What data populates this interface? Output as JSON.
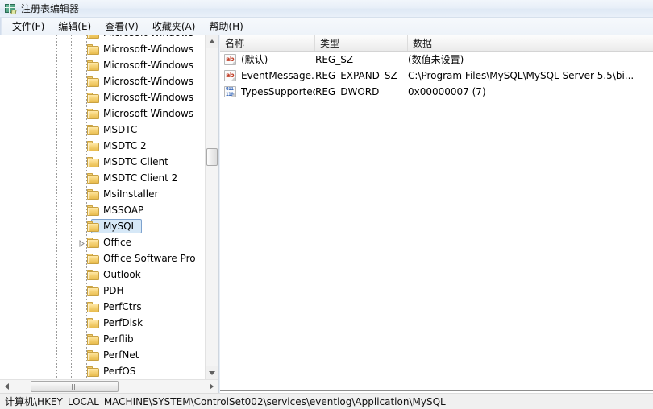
{
  "window": {
    "title": "注册表编辑器",
    "icon": "regedit-icon"
  },
  "menubar": {
    "items": [
      {
        "label": "文件(F)",
        "name": "menu-file"
      },
      {
        "label": "编辑(E)",
        "name": "menu-edit"
      },
      {
        "label": "查看(V)",
        "name": "menu-view"
      },
      {
        "label": "收藏夹(A)",
        "name": "menu-favorites"
      },
      {
        "label": "帮助(H)",
        "name": "menu-help"
      }
    ]
  },
  "tree": {
    "items": [
      {
        "label": "Microsoft-Windows",
        "selected": false,
        "expandable": false
      },
      {
        "label": "Microsoft-Windows",
        "selected": false,
        "expandable": false
      },
      {
        "label": "Microsoft-Windows",
        "selected": false,
        "expandable": false
      },
      {
        "label": "Microsoft-Windows",
        "selected": false,
        "expandable": false
      },
      {
        "label": "Microsoft-Windows",
        "selected": false,
        "expandable": false
      },
      {
        "label": "Microsoft-Windows",
        "selected": false,
        "expandable": false
      },
      {
        "label": "MSDTC",
        "selected": false,
        "expandable": false
      },
      {
        "label": "MSDTC 2",
        "selected": false,
        "expandable": false
      },
      {
        "label": "MSDTC Client",
        "selected": false,
        "expandable": false
      },
      {
        "label": "MSDTC Client 2",
        "selected": false,
        "expandable": false
      },
      {
        "label": "MsiInstaller",
        "selected": false,
        "expandable": false
      },
      {
        "label": "MSSOAP",
        "selected": false,
        "expandable": false
      },
      {
        "label": "MySQL",
        "selected": true,
        "expandable": false
      },
      {
        "label": "Office",
        "selected": false,
        "expandable": true
      },
      {
        "label": "Office Software Pro",
        "selected": false,
        "expandable": false
      },
      {
        "label": "Outlook",
        "selected": false,
        "expandable": false
      },
      {
        "label": "PDH",
        "selected": false,
        "expandable": false
      },
      {
        "label": "PerfCtrs",
        "selected": false,
        "expandable": false
      },
      {
        "label": "PerfDisk",
        "selected": false,
        "expandable": false
      },
      {
        "label": "Perflib",
        "selected": false,
        "expandable": false
      },
      {
        "label": "PerfNet",
        "selected": false,
        "expandable": false
      },
      {
        "label": "PerfOS",
        "selected": false,
        "expandable": false
      }
    ]
  },
  "list": {
    "columns": [
      {
        "label": "名称",
        "name": "column-name"
      },
      {
        "label": "类型",
        "name": "column-type"
      },
      {
        "label": "数据",
        "name": "column-data"
      }
    ],
    "rows": [
      {
        "name": "(默认)",
        "type": "REG_SZ",
        "data": "(数值未设置)",
        "icon": "string-value-icon"
      },
      {
        "name": "EventMessage...",
        "type": "REG_EXPAND_SZ",
        "data": "C:\\Program Files\\MySQL\\MySQL Server 5.5\\bi...",
        "icon": "string-value-icon"
      },
      {
        "name": "TypesSupported",
        "type": "REG_DWORD",
        "data": "0x00000007 (7)",
        "icon": "binary-value-icon"
      }
    ]
  },
  "statusbar": {
    "path": "计算机\\HKEY_LOCAL_MACHINE\\SYSTEM\\ControlSet002\\services\\eventlog\\Application\\MySQL"
  },
  "colors": {
    "selection_fill": "#d6e8f7",
    "selection_border": "#7da2ce",
    "string_icon": "#c03a22",
    "binary_icon": "#2b5fb5",
    "folder": "#f6d479"
  }
}
